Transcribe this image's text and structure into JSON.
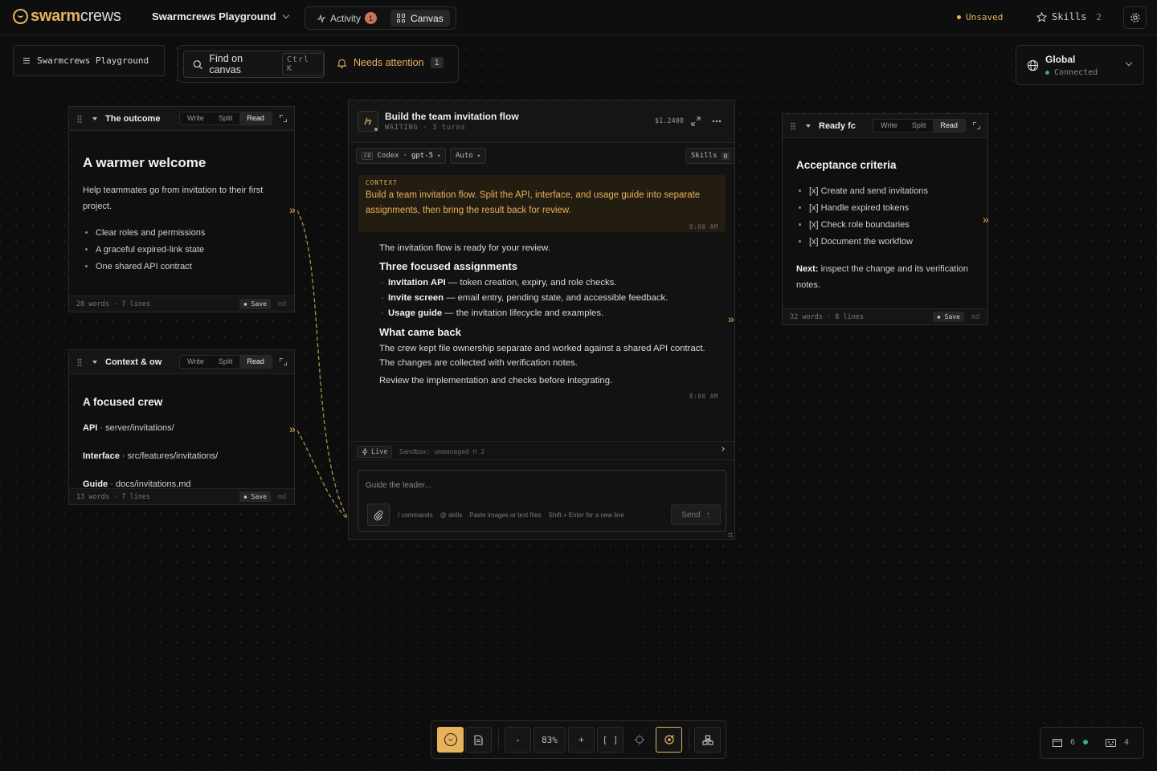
{
  "header": {
    "brand_a": "swarm",
    "brand_b": "crews",
    "project_name": "Swarmcrews Playground",
    "tabs": [
      {
        "label": "Activity",
        "badge": "1"
      },
      {
        "label": "Canvas",
        "active": true
      }
    ],
    "unsaved_label": "Unsaved",
    "skills_label": "Skills",
    "skills_count": "2",
    "accent_color": "#e6b25c"
  },
  "toolbar": {
    "playground_label": "Swarmcrews Playground",
    "find_label": "Find on canvas",
    "find_shortcut": "Ctrl K",
    "needs_label": "Needs attention",
    "needs_count": "1"
  },
  "scope": {
    "title": "Global",
    "status": "Connected"
  },
  "modes": {
    "write": "Write",
    "split": "Split",
    "read": "Read"
  },
  "save_label": "Save",
  "md_label": "md",
  "notes": {
    "outcome": {
      "title": "The outcome",
      "heading": "A warmer welcome",
      "paragraph": "Help teammates go from invitation to their first project.",
      "bullets": [
        "Clear roles and permissions",
        "A graceful expired-link state",
        "One shared API contract"
      ],
      "stats": "28 words · 7 lines"
    },
    "context": {
      "title": "Context & ow",
      "heading": "A focused crew",
      "rows": [
        {
          "label": "API",
          "value": "· server/invitations/"
        },
        {
          "label": "Interface",
          "value": "· src/features/invitations/"
        },
        {
          "label": "Guide",
          "value": "· docs/invitations.md"
        }
      ],
      "stats": "13 words · 7 lines"
    },
    "ready": {
      "title": "Ready fc",
      "heading": "Acceptance criteria",
      "bullets": [
        "[x] Create and send invitations",
        "[x] Handle expired tokens",
        "[x] Check role boundaries",
        "[x] Document the workflow"
      ],
      "next_label": "Next:",
      "next_text": "inspect the change and its verification notes.",
      "stats": "32 words · 8 lines"
    }
  },
  "chat": {
    "title": "Build the team invitation flow",
    "status": "WAITING",
    "turns": "3 turns",
    "cost": "$1.2400",
    "agent_tag": "CO",
    "agent": "Codex",
    "model": "gpt-5",
    "mode": "Auto",
    "skills_label": "Skills",
    "skills_count": "0",
    "context_label": "CONTEXT",
    "context_text": "Build a team invitation flow. Split the API, interface, and usage guide into separate assignments, then bring the result back for review.",
    "context_time": "8:00 AM",
    "reply": {
      "intro": "The invitation flow is ready for your review.",
      "h1": "Three focused assignments",
      "items": [
        {
          "strong": "Invitation API",
          "text": " — token creation, expiry, and role checks."
        },
        {
          "strong": "Invite screen",
          "text": " — email entry, pending state, and accessible feedback."
        },
        {
          "strong": "Usage guide",
          "text": " — the invitation lifecycle and examples."
        }
      ],
      "h2": "What came back",
      "p1": "The crew kept file ownership separate and worked against a shared API contract.",
      "p2": "The changes are collected with verification notes.",
      "p3": "Review the implementation and checks before integrating.",
      "time": "8:00 AM"
    },
    "live_label": "Live",
    "sandbox": "Sandbox: unmanaged",
    "lock_count": "2",
    "compose_placeholder": "Guide the leader...",
    "hints": [
      "/ commands",
      "@ skills",
      "Paste images or text files",
      "Shift + Enter for a new line"
    ],
    "send_label": "Send"
  },
  "bottom": {
    "zoom_out": "-",
    "zoom": "83%",
    "zoom_in": "+",
    "fit": "[ ]"
  },
  "counts": {
    "windows": "6",
    "agents": "4"
  }
}
